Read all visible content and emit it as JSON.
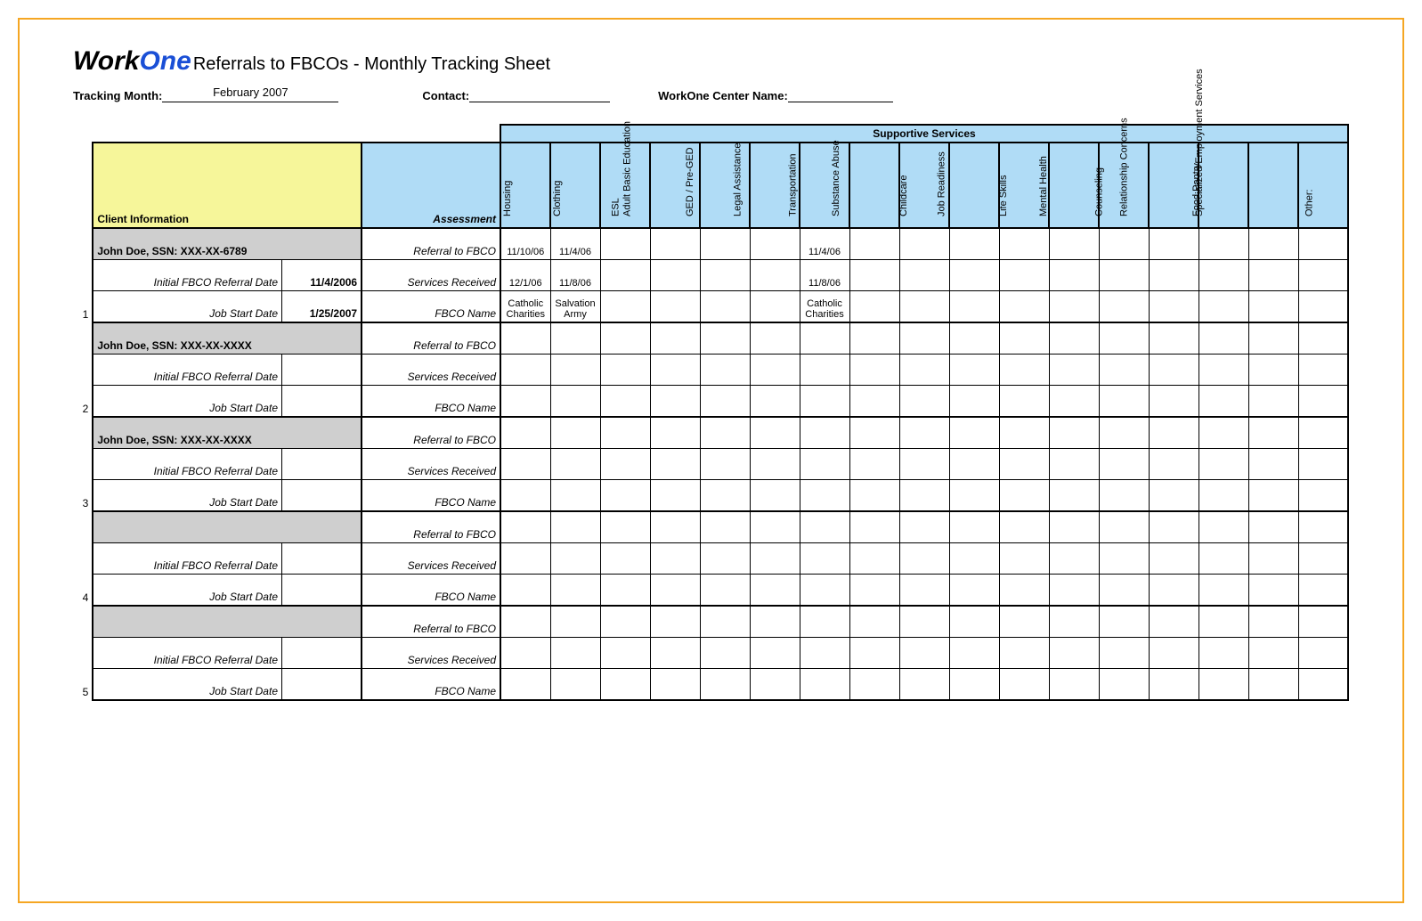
{
  "logo": {
    "part1": "Work",
    "part2": "One"
  },
  "title": "Referrals to FBCOs - Monthly Tracking Sheet",
  "meta": {
    "tracking_month_label": "Tracking Month:",
    "tracking_month_value": "February 2007",
    "contact_label": "Contact:",
    "contact_value": "",
    "center_label": "WorkOne Center Name:",
    "center_value": ""
  },
  "headers": {
    "supportive": "Supportive Services",
    "client_info": "Client Information",
    "assessment": "Assessment",
    "services": [
      "Housing",
      "Clothing",
      "ESL",
      "Adult Basic Education",
      "GED / Pre-GED",
      "Legal Assistance",
      "Transportation",
      "Substance Abuse",
      "Childcare",
      "Job Readiness",
      "Life Skills",
      "Mental Health",
      "Counseling",
      "Relationship Concerns",
      "Food Pantry",
      "Specialized Employment Services",
      "Other:"
    ]
  },
  "row_labels": {
    "initial_referral": "Initial FBCO Referral Date",
    "job_start": "Job Start Date",
    "referral_to_fbco": "Referral to FBCO",
    "services_received": "Services Received",
    "fbco_name": "FBCO Name"
  },
  "clients": [
    {
      "num": "1",
      "name": "John Doe, SSN: XXX-XX-6789",
      "initial_date": "11/4/2006",
      "job_start_date": "1/25/2007",
      "rows": [
        {
          "label_key": "referral_to_fbco",
          "svc": [
            "11/10/06",
            "11/4/06",
            "",
            "",
            "",
            "",
            "11/4/06",
            "",
            "",
            "",
            "",
            "",
            "",
            "",
            "",
            "",
            ""
          ]
        },
        {
          "label_key": "services_received",
          "svc": [
            "12/1/06",
            "11/8/06",
            "",
            "",
            "",
            "",
            "11/8/06",
            "",
            "",
            "",
            "",
            "",
            "",
            "",
            "",
            "",
            ""
          ]
        },
        {
          "label_key": "fbco_name",
          "svc": [
            "Catholic Charities",
            "Salvation Army",
            "",
            "",
            "",
            "",
            "Catholic Charities",
            "",
            "",
            "",
            "",
            "",
            "",
            "",
            "",
            "",
            ""
          ]
        }
      ]
    },
    {
      "num": "2",
      "name": "John Doe, SSN: XXX-XX-XXXX",
      "initial_date": "",
      "job_start_date": "",
      "rows": [
        {
          "label_key": "referral_to_fbco",
          "svc": [
            "",
            "",
            "",
            "",
            "",
            "",
            "",
            "",
            "",
            "",
            "",
            "",
            "",
            "",
            "",
            "",
            ""
          ]
        },
        {
          "label_key": "services_received",
          "svc": [
            "",
            "",
            "",
            "",
            "",
            "",
            "",
            "",
            "",
            "",
            "",
            "",
            "",
            "",
            "",
            "",
            ""
          ]
        },
        {
          "label_key": "fbco_name",
          "svc": [
            "",
            "",
            "",
            "",
            "",
            "",
            "",
            "",
            "",
            "",
            "",
            "",
            "",
            "",
            "",
            "",
            ""
          ]
        }
      ]
    },
    {
      "num": "3",
      "name": "John Doe, SSN: XXX-XX-XXXX",
      "initial_date": "",
      "job_start_date": "",
      "rows": [
        {
          "label_key": "referral_to_fbco",
          "svc": [
            "",
            "",
            "",
            "",
            "",
            "",
            "",
            "",
            "",
            "",
            "",
            "",
            "",
            "",
            "",
            "",
            ""
          ]
        },
        {
          "label_key": "services_received",
          "svc": [
            "",
            "",
            "",
            "",
            "",
            "",
            "",
            "",
            "",
            "",
            "",
            "",
            "",
            "",
            "",
            "",
            ""
          ]
        },
        {
          "label_key": "fbco_name",
          "svc": [
            "",
            "",
            "",
            "",
            "",
            "",
            "",
            "",
            "",
            "",
            "",
            "",
            "",
            "",
            "",
            "",
            ""
          ]
        }
      ]
    },
    {
      "num": "4",
      "name": "",
      "initial_date": "",
      "job_start_date": "",
      "rows": [
        {
          "label_key": "referral_to_fbco",
          "svc": [
            "",
            "",
            "",
            "",
            "",
            "",
            "",
            "",
            "",
            "",
            "",
            "",
            "",
            "",
            "",
            "",
            ""
          ]
        },
        {
          "label_key": "services_received",
          "svc": [
            "",
            "",
            "",
            "",
            "",
            "",
            "",
            "",
            "",
            "",
            "",
            "",
            "",
            "",
            "",
            "",
            ""
          ]
        },
        {
          "label_key": "fbco_name",
          "svc": [
            "",
            "",
            "",
            "",
            "",
            "",
            "",
            "",
            "",
            "",
            "",
            "",
            "",
            "",
            "",
            "",
            ""
          ]
        }
      ]
    },
    {
      "num": "5",
      "name": "",
      "initial_date": "",
      "job_start_date": "",
      "rows": [
        {
          "label_key": "referral_to_fbco",
          "svc": [
            "",
            "",
            "",
            "",
            "",
            "",
            "",
            "",
            "",
            "",
            "",
            "",
            "",
            "",
            "",
            "",
            ""
          ]
        },
        {
          "label_key": "services_received",
          "svc": [
            "",
            "",
            "",
            "",
            "",
            "",
            "",
            "",
            "",
            "",
            "",
            "",
            "",
            "",
            "",
            "",
            ""
          ]
        },
        {
          "label_key": "fbco_name",
          "svc": [
            "",
            "",
            "",
            "",
            "",
            "",
            "",
            "",
            "",
            "",
            "",
            "",
            "",
            "",
            "",
            "",
            ""
          ]
        }
      ]
    }
  ]
}
